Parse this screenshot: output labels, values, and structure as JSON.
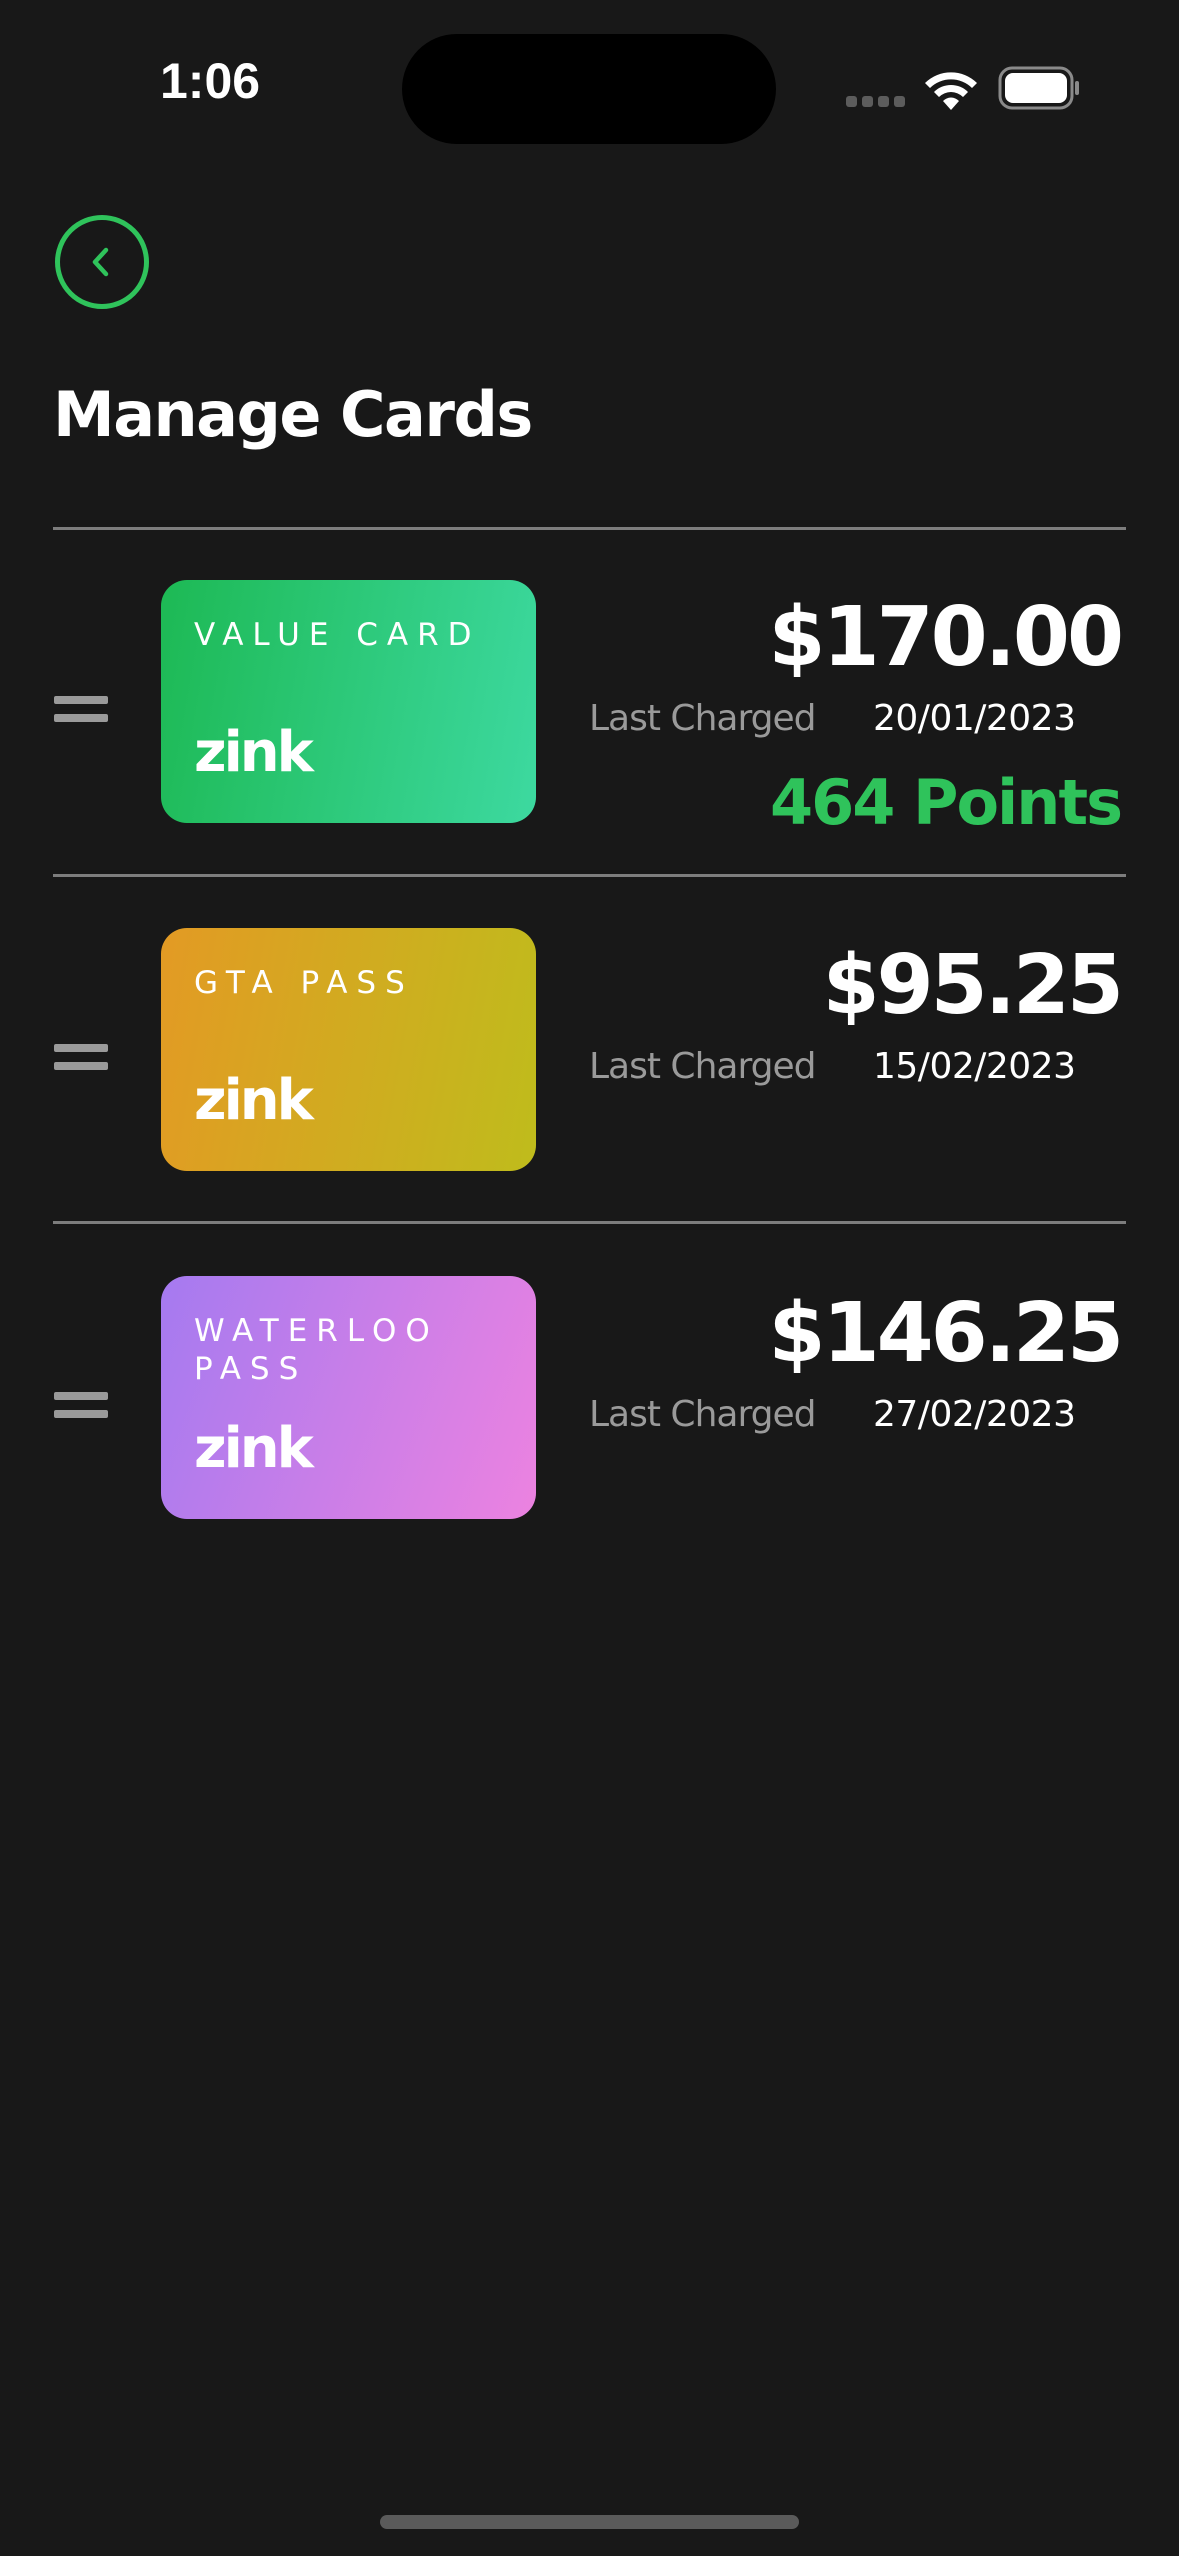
{
  "status_bar": {
    "time": "1:06"
  },
  "header": {
    "back_icon": "chevron-left-icon",
    "title": "Manage Cards"
  },
  "colors": {
    "background": "#181818",
    "accent": "#2fc35b"
  },
  "cards": [
    {
      "name": "VALUE CARD",
      "logo": "zink",
      "balance": "$170.00",
      "last_charged_label": "Last Charged",
      "last_charged_date": "20/01/2023",
      "points": "464 Points",
      "gradient": [
        "#1db954",
        "#3dd9a0"
      ]
    },
    {
      "name": "GTA PASS",
      "logo": "zink",
      "balance": "$95.25",
      "last_charged_label": "Last Charged",
      "last_charged_date": "15/02/2023",
      "gradient": [
        "#e39a24",
        "#bfbc1c"
      ]
    },
    {
      "name": "WATERLOO PASS",
      "logo": "zink",
      "balance": "$146.25",
      "last_charged_label": "Last Charged",
      "last_charged_date": "27/02/2023",
      "gradient": [
        "#a57af0",
        "#ec82e0"
      ]
    }
  ]
}
